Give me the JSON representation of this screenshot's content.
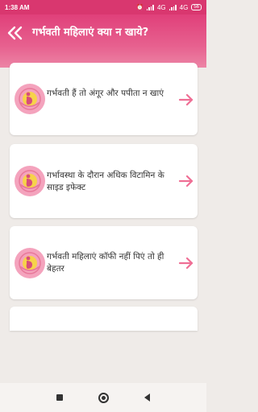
{
  "status_bar": {
    "time": "1:38 AM",
    "network_1": "4G",
    "network_2": "4G",
    "battery": "56"
  },
  "header": {
    "title": "गर्भवती महिलाएं क्या न खाये?",
    "back_icon": "double-chevron-left-icon"
  },
  "articles": [
    {
      "label": "गर्भवती हैं तो अंगूर और पपीता न खाएं",
      "icon": "pregnant-woman-logo-icon"
    },
    {
      "label": "गर्भावस्था के दौरान अधिक विटामिन के साइड इफेक्ट",
      "icon": "pregnant-woman-logo-icon"
    },
    {
      "label": "गर्भवती महिलाएं कॉफी नहीं पिएं तो ही बेहतर",
      "icon": "pregnant-woman-logo-icon"
    }
  ],
  "colors": {
    "header": "#e0407a",
    "accent": "#ef6f95",
    "logo_bg": "#f4a3bd"
  }
}
